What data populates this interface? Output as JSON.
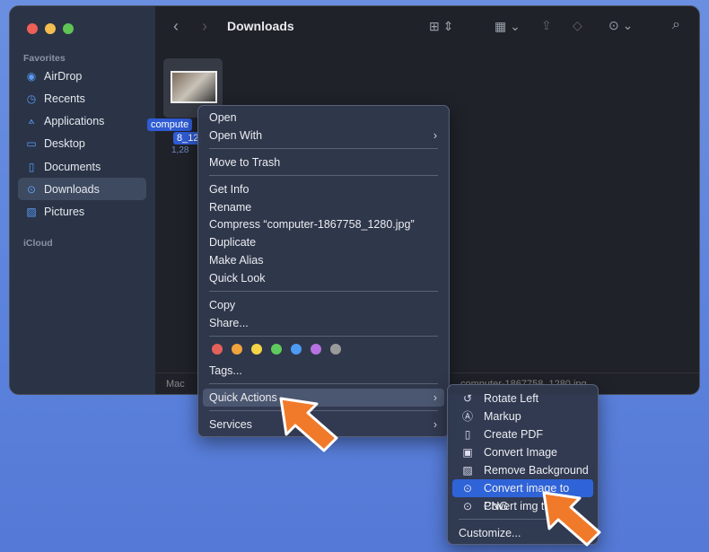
{
  "window": {
    "title": "Downloads"
  },
  "sidebar": {
    "favorites_label": "Favorites",
    "icloud_label": "iCloud",
    "items": [
      {
        "label": "AirDrop",
        "icon": "airdrop-icon",
        "glyph": "◉"
      },
      {
        "label": "Recents",
        "icon": "clock-icon",
        "glyph": "◷"
      },
      {
        "label": "Applications",
        "icon": "applications-icon",
        "glyph": "⟑"
      },
      {
        "label": "Desktop",
        "icon": "desktop-icon",
        "glyph": "▭"
      },
      {
        "label": "Documents",
        "icon": "document-icon",
        "glyph": "▯"
      },
      {
        "label": "Downloads",
        "icon": "download-icon",
        "glyph": "⊙",
        "selected": true
      },
      {
        "label": "Pictures",
        "icon": "pictures-icon",
        "glyph": "▨"
      }
    ]
  },
  "file": {
    "name_line1": "compute",
    "name_line2": "8_12",
    "size": "1,28"
  },
  "pathbar": {
    "disk": "Mac",
    "file": "computer-1867758_1280.jpg"
  },
  "context_menu": {
    "items": [
      "Open",
      "Open With",
      "Move to Trash",
      "Get Info",
      "Rename",
      "Compress “computer-1867758_1280.jpg”",
      "Duplicate",
      "Make Alias",
      "Quick Look",
      "Copy",
      "Share...",
      "Tags...",
      "Quick Actions",
      "Services"
    ],
    "tag_colors": [
      "#e5605a",
      "#f1a33c",
      "#f5d547",
      "#5fcb5c",
      "#4c9bf5",
      "#b772e2",
      "#9a9a9a"
    ]
  },
  "quick_actions": {
    "items": [
      "Rotate Left",
      "Markup",
      "Create PDF",
      "Convert Image",
      "Remove Background",
      "Convert image to PNG",
      "Covert img to",
      "Customize..."
    ]
  },
  "colors": {
    "accent": "#2f63d8",
    "arrow": "#f07a2a"
  }
}
